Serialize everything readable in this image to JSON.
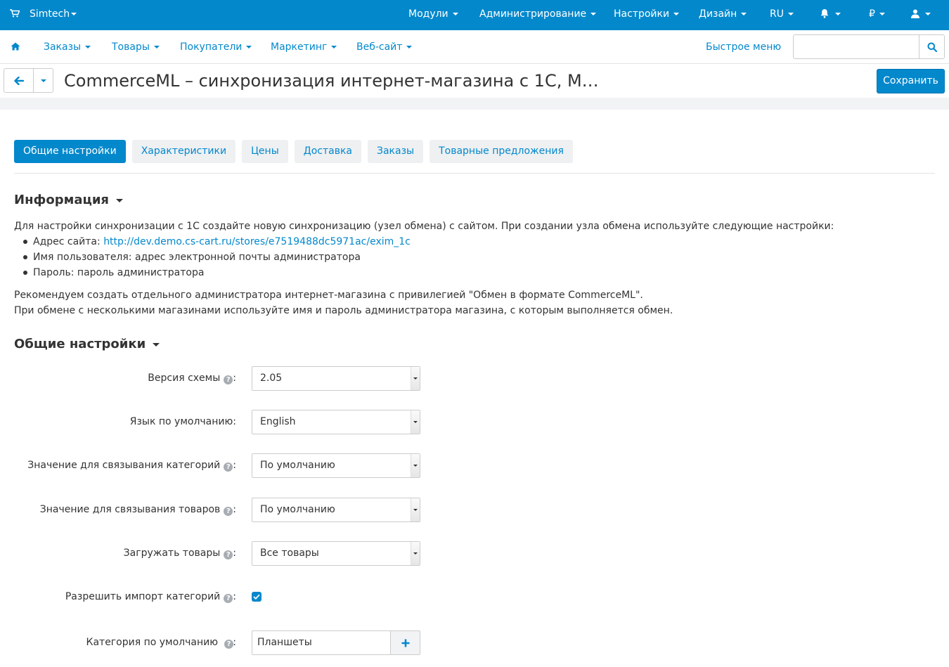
{
  "topbar": {
    "brand": "Simtech",
    "menus": [
      "Модули",
      "Администрирование",
      "Настройки",
      "Дизайн"
    ],
    "language": "RU",
    "currency": "₽"
  },
  "nav": {
    "items": [
      "Заказы",
      "Товары",
      "Покупатели",
      "Маркетинг",
      "Веб-сайт"
    ],
    "quick_menu": "Быстрое меню",
    "search_placeholder": ""
  },
  "header": {
    "title": "CommerceML – синхронизация интернет-магазина с 1С, Mo...",
    "save_label": "Сохранить"
  },
  "tabs": [
    {
      "label": "Общие настройки",
      "active": true
    },
    {
      "label": "Характеристики",
      "active": false
    },
    {
      "label": "Цены",
      "active": false
    },
    {
      "label": "Доставка",
      "active": false
    },
    {
      "label": "Заказы",
      "active": false
    },
    {
      "label": "Товарные предложения",
      "active": false
    }
  ],
  "info": {
    "title": "Информация",
    "intro": "Для настройки синхронизации с 1С создайте новую синхронизацию (узел обмена) с сайтом. При создании узла обмена используйте следующие настройки:",
    "site_label": "Адрес сайта: ",
    "site_url": "http://dev.demo.cs-cart.ru/stores/e7519488dc5971ac/exim_1c",
    "user_line": "Имя пользователя: адрес электронной почты администратора",
    "password_line": "Пароль: пароль администратора",
    "note1": "Рекомендуем создать отдельного администратора интернет-магазина с привилегией \"Обмен в формате CommerceML\".",
    "note2": "При обмене с несколькими магазинами используйте имя и пароль администратора магазина, с которым выполняется обмен."
  },
  "general": {
    "title": "Общие настройки",
    "schema_version": {
      "label": "Версия схемы",
      "value": "2.05"
    },
    "default_language": {
      "label": "Язык по умолчанию:",
      "value": "English"
    },
    "category_link": {
      "label": "Значение для связывания категорий",
      "value": "По умолчанию"
    },
    "product_link": {
      "label": "Значение для связывания товаров",
      "value": "По умолчанию"
    },
    "load_products": {
      "label": "Загружать товары",
      "value": "Все товары"
    },
    "allow_category_import": {
      "label": "Разрешить импорт категорий",
      "checked": true
    },
    "default_category": {
      "label": "Категория по умолчанию",
      "value": "Планшеты"
    }
  },
  "colors": {
    "accent": "#0388cc"
  }
}
